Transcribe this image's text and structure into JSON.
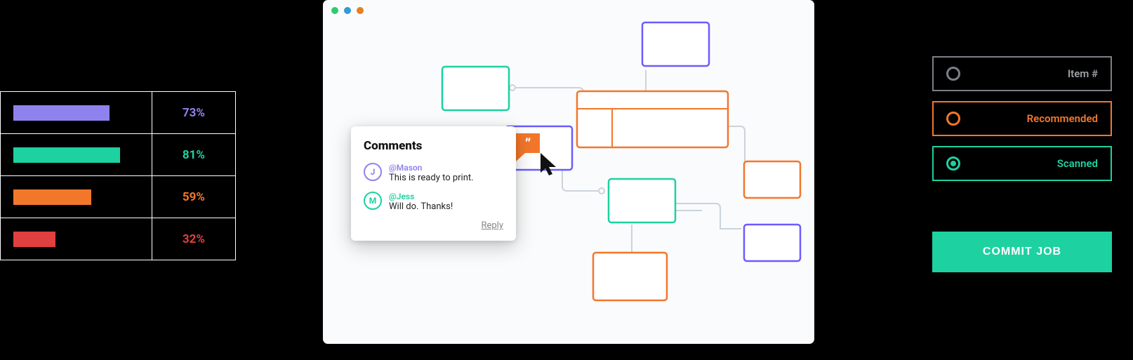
{
  "progress_table": [
    {
      "color": "purple",
      "pct": 73,
      "pct_label": "73%"
    },
    {
      "color": "teal",
      "pct": 81,
      "pct_label": "81%"
    },
    {
      "color": "orange",
      "pct": 59,
      "pct_label": "59%"
    },
    {
      "color": "red",
      "pct": 32,
      "pct_label": "32%"
    }
  ],
  "chart_data": {
    "type": "bar",
    "orientation": "horizontal",
    "categories": [
      "purple",
      "teal",
      "orange",
      "red"
    ],
    "values": [
      73,
      81,
      59,
      32
    ],
    "ylim": [
      0,
      100
    ],
    "title": "",
    "xlabel": "",
    "ylabel": "",
    "colors": {
      "purple": "#8e82ef",
      "teal": "#1dd1a1",
      "orange": "#f3772b",
      "red": "#e04040"
    }
  },
  "workflow_window": {
    "comments": {
      "title": "Comments",
      "entries": [
        {
          "avatar_letter": "J",
          "avatar_color": "purple",
          "handle": "@Mason",
          "handle_color": "purple",
          "msg": "This is ready to print."
        },
        {
          "avatar_letter": "M",
          "avatar_color": "teal",
          "handle": "@Jess",
          "handle_color": "teal",
          "msg": "Will do. Thanks!"
        }
      ],
      "reply_label": "Reply"
    }
  },
  "legend": {
    "items": [
      {
        "style": "grey",
        "label": "Item #"
      },
      {
        "style": "orange",
        "label": "Recommended"
      },
      {
        "style": "teal",
        "label": "Scanned"
      }
    ]
  },
  "commit_button_label": "COMMIT JOB"
}
